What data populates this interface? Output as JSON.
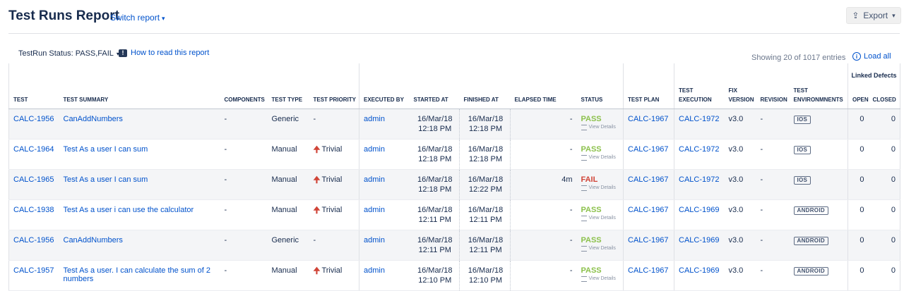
{
  "header": {
    "title": "Test Runs Report",
    "switch_label": "Switch report",
    "export_label": "Export"
  },
  "toolbar": {
    "filter_label": "TestRun Status: PASS,FAIL",
    "howto_label": "How to read this report",
    "showing": "Showing 20 of 1017 entries",
    "load_all": "Load all"
  },
  "table": {
    "linked_defects": "Linked Defects",
    "columns": {
      "test": "TEST",
      "summary": "TEST SUMMARY",
      "components": "COMPONENTS",
      "type": "TEST TYPE",
      "priority": "TEST PRIORITY",
      "executed_by": "EXECUTED BY",
      "started": "STARTED AT",
      "finished": "FINISHED AT",
      "elapsed": "ELAPSED TIME",
      "status": "STATUS",
      "plan": "TEST PLAN",
      "execution": "TEST EXECUTION",
      "fix": "FIX VERSION",
      "revision": "REVISION",
      "env": "TEST ENVIRONMNENTS",
      "open": "OPEN",
      "closed": "CLOSED"
    },
    "view_details": "View Details",
    "rows": [
      {
        "test": "CALC-1956",
        "summary": "CanAddNumbers",
        "components": "-",
        "type": "Generic",
        "priority": "-",
        "executed_by": "admin",
        "started_date": "16/Mar/18",
        "started_time": "12:18 PM",
        "finished_date": "16/Mar/18",
        "finished_time": "12:18 PM",
        "elapsed": "-",
        "status": "PASS",
        "plan": "CALC-1967",
        "execution": "CALC-1972",
        "fix": "v3.0",
        "revision": "-",
        "env": "IOS",
        "open": "0",
        "closed": "0"
      },
      {
        "test": "CALC-1964",
        "summary": "Test As a user I can sum",
        "components": "-",
        "type": "Manual",
        "priority": "Trivial",
        "executed_by": "admin",
        "started_date": "16/Mar/18",
        "started_time": "12:18 PM",
        "finished_date": "16/Mar/18",
        "finished_time": "12:18 PM",
        "elapsed": "-",
        "status": "PASS",
        "plan": "CALC-1967",
        "execution": "CALC-1972",
        "fix": "v3.0",
        "revision": "-",
        "env": "IOS",
        "open": "0",
        "closed": "0"
      },
      {
        "test": "CALC-1965",
        "summary": "Test As a user I can sum",
        "components": "-",
        "type": "Manual",
        "priority": "Trivial",
        "executed_by": "admin",
        "started_date": "16/Mar/18",
        "started_time": "12:18 PM",
        "finished_date": "16/Mar/18",
        "finished_time": "12:22 PM",
        "elapsed": "4m",
        "status": "FAIL",
        "plan": "CALC-1967",
        "execution": "CALC-1972",
        "fix": "v3.0",
        "revision": "-",
        "env": "IOS",
        "open": "0",
        "closed": "0"
      },
      {
        "test": "CALC-1938",
        "summary": "Test As a user i can use the calculator",
        "components": "-",
        "type": "Manual",
        "priority": "Trivial",
        "executed_by": "admin",
        "started_date": "16/Mar/18",
        "started_time": "12:11 PM",
        "finished_date": "16/Mar/18",
        "finished_time": "12:11 PM",
        "elapsed": "-",
        "status": "PASS",
        "plan": "CALC-1967",
        "execution": "CALC-1969",
        "fix": "v3.0",
        "revision": "-",
        "env": "ANDROID",
        "open": "0",
        "closed": "0"
      },
      {
        "test": "CALC-1956",
        "summary": "CanAddNumbers",
        "components": "-",
        "type": "Generic",
        "priority": "-",
        "executed_by": "admin",
        "started_date": "16/Mar/18",
        "started_time": "12:11 PM",
        "finished_date": "16/Mar/18",
        "finished_time": "12:11 PM",
        "elapsed": "-",
        "status": "PASS",
        "plan": "CALC-1967",
        "execution": "CALC-1969",
        "fix": "v3.0",
        "revision": "-",
        "env": "ANDROID",
        "open": "0",
        "closed": "0"
      },
      {
        "test": "CALC-1957",
        "summary": "Test As a user. I can calculate the sum of 2 numbers",
        "components": "-",
        "type": "Manual",
        "priority": "Trivial",
        "executed_by": "admin",
        "started_date": "16/Mar/18",
        "started_time": "12:10 PM",
        "finished_date": "16/Mar/18",
        "finished_time": "12:10 PM",
        "elapsed": "-",
        "status": "PASS",
        "plan": "CALC-1967",
        "execution": "CALC-1969",
        "fix": "v3.0",
        "revision": "-",
        "env": "ANDROID",
        "open": "0",
        "closed": "0"
      }
    ]
  }
}
